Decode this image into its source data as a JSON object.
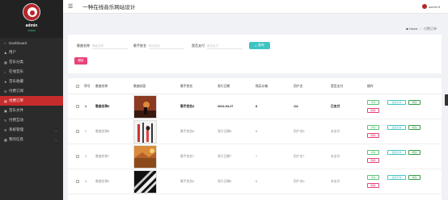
{
  "sidebar": {
    "admin_name": "admin",
    "status": "Online",
    "items": [
      {
        "label": "Dashboard",
        "icon": "home-icon",
        "glyph": "⌂"
      },
      {
        "label": "用户",
        "icon": "user-icon",
        "glyph": "♟"
      },
      {
        "label": "音乐分类",
        "icon": "category-icon",
        "glyph": "▦"
      },
      {
        "label": "在线音乐",
        "icon": "music-icon",
        "glyph": "♪"
      },
      {
        "label": "音乐收藏",
        "icon": "star-icon",
        "glyph": "★"
      },
      {
        "label": "付费订阅",
        "icon": "list-icon",
        "glyph": "☰"
      },
      {
        "label": "付费订单",
        "icon": "order-icon",
        "glyph": "▤"
      },
      {
        "label": "音乐文件",
        "icon": "file-icon",
        "glyph": "▣"
      },
      {
        "label": "付费互动",
        "icon": "comment-icon",
        "glyph": "✎"
      },
      {
        "label": "系统管理",
        "icon": "settings-icon",
        "glyph": "⚙",
        "has_caret": true
      },
      {
        "label": "我的信息",
        "icon": "info-icon",
        "glyph": "▩",
        "has_caret": true
      }
    ],
    "active_index": 6
  },
  "topbar": {
    "title": "一种在线音乐网站设计",
    "user_label": "admin",
    "user_caret": "▾"
  },
  "breadcrumb": {
    "home": "Home",
    "separator": "/",
    "current": "付费订单"
  },
  "search": {
    "fields": [
      {
        "label": "歌曲名称",
        "placeholder": "歌曲名称"
      },
      {
        "label": "歌手姓名",
        "placeholder": "歌手姓名"
      },
      {
        "label": "是否支付",
        "placeholder": "是否支付"
      }
    ],
    "search_button": "查询",
    "delete_button": "删除"
  },
  "table": {
    "columns": [
      "序号",
      "歌曲名称",
      "歌曲封面",
      "歌手姓名",
      "发行日期",
      "购买价格",
      "用户名",
      "是否支付",
      "操作"
    ],
    "actions": {
      "detail": "详情",
      "send": "发送文件",
      "edit": "修改",
      "delete": "删除"
    },
    "rows": [
      {
        "index": "1",
        "song": "歌曲名称8",
        "singer": "歌手姓名8",
        "date": "2024-03-27",
        "price": "8",
        "user": "111",
        "paid": "已支付",
        "highlight": true
      },
      {
        "index": "2",
        "song": "歌曲名称8",
        "singer": "歌手姓名8",
        "date": "发行日期8",
        "price": "8",
        "user": "用户名8",
        "paid": "未支付",
        "highlight": false
      },
      {
        "index": "3",
        "song": "歌曲名称7",
        "singer": "歌手姓名7",
        "date": "发行日期7",
        "price": "7",
        "user": "用户名7",
        "paid": "未支付",
        "highlight": false
      },
      {
        "index": "4",
        "song": "歌曲名称6",
        "singer": "歌手姓名6",
        "date": "发行日期6",
        "price": "6",
        "user": "用户名6",
        "paid": "未支付",
        "highlight": false
      }
    ]
  },
  "colors": {
    "sidebar_bg": "#2b2b2b",
    "active_menu": "#c72c2c",
    "search_button": "#3fc4c4",
    "delete_button": "#e8437a"
  }
}
